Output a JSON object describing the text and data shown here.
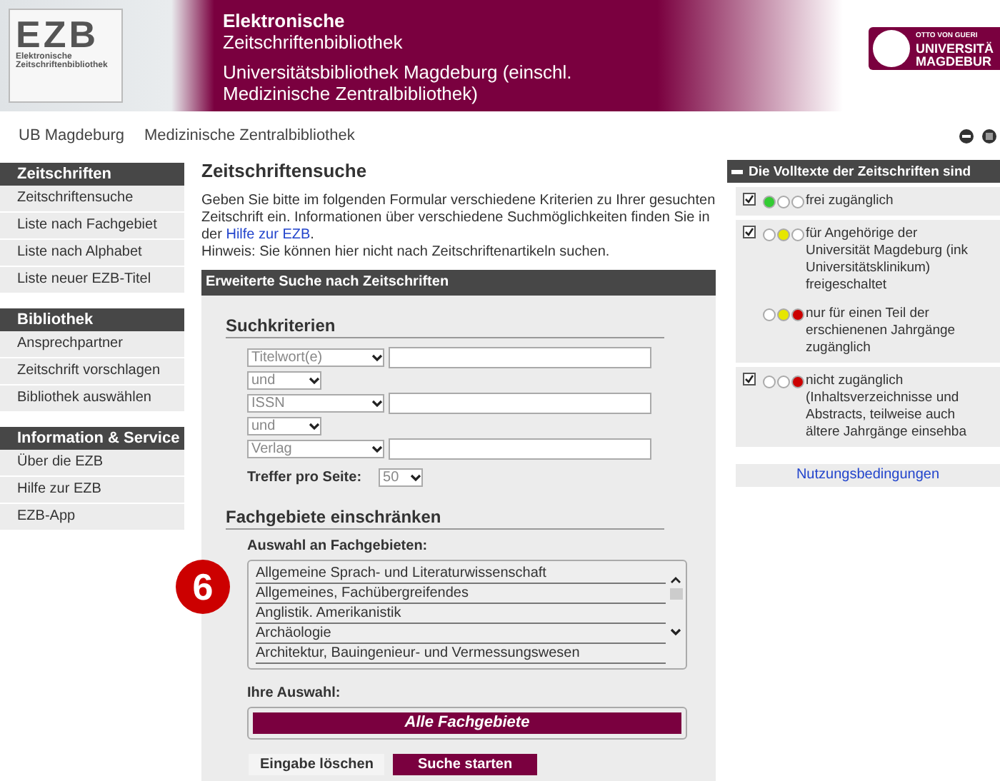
{
  "header": {
    "logo": {
      "letters": "EZB",
      "line1": "Elektronische",
      "line2": "Zeitschriftenbibliothek"
    },
    "title": "Elektronische",
    "subtitle": "Zeitschriftenbibliothek",
    "library": "Universitätsbibliothek Magdeburg (einschl. Medizinische Zentralbibliothek)",
    "uni_logo": {
      "small": "OTTO VON GUERI",
      "line1": "UNIVERSITÄ",
      "line2": "MAGDEBUR"
    }
  },
  "nav_links": [
    "UB Magdeburg",
    "Medizinische Zentralbibliothek"
  ],
  "sidebar": [
    {
      "heading": "Zeitschriften",
      "items": [
        "Zeitschriftensuche",
        "Liste nach Fachgebiet",
        "Liste nach Alphabet",
        "Liste neuer EZB-Titel"
      ]
    },
    {
      "heading": "Bibliothek",
      "items": [
        "Ansprechpartner",
        "Zeitschrift vorschlagen",
        "Bibliothek auswählen"
      ]
    },
    {
      "heading": "Information & Service",
      "items": [
        "Über die EZB",
        "Hilfe zur EZB",
        "EZB-App"
      ]
    }
  ],
  "main": {
    "title": "Zeitschriftensuche",
    "intro": "Geben Sie bitte im folgenden Formular verschiedene Kriterien zu Ihrer gesuchten Zeitschrift ein. Informationen über verschiedene Suchmöglichkeiten finden Sie in der",
    "intro_link": "Hilfe zur EZB",
    "intro_end": ".",
    "hint": "Hinweis: Sie können hier nicht nach Zeitschriftenartikeln suchen.",
    "panel_title": "Erweiterte Suche nach Zeitschriften",
    "criteria_heading": "Suchkriterien",
    "criteria": [
      {
        "field": "Titelwort(e)",
        "operator": "und"
      },
      {
        "field": "ISSN",
        "operator": "und"
      },
      {
        "field": "Verlag"
      }
    ],
    "hits_label": "Treffer pro Seite:",
    "hits_value": "50",
    "subjects_heading": "Fachgebiete einschränken",
    "subjects_label": "Auswahl an Fachgebieten:",
    "subjects": [
      "Allgemeine Sprach- und Literaturwissenschaft",
      "Allgemeines, Fachübergreifendes",
      "Anglistik. Amerikanistik",
      "Archäologie",
      "Architektur, Bauingenieur- und Vermessungswesen"
    ],
    "selection_label": "Ihre Auswahl:",
    "selection": "Alle Fachgebiete",
    "buttons": [
      {
        "label": "Eingabe löschen",
        "kind": "plain"
      },
      {
        "label": "Suche starten",
        "kind": "primary"
      }
    ]
  },
  "annotation": "6",
  "legend": {
    "title": "Die Volltexte der Zeitschriften sind",
    "groups": [
      {
        "rows": [
          {
            "checked": true,
            "lights": [
              {
                "color": "#33cc33"
              },
              {
                "color": "#ffffff"
              },
              {
                "color": "#ffffff"
              }
            ],
            "lines": [
              "frei zugänglich"
            ]
          }
        ]
      },
      {
        "rows": [
          {
            "checked": true,
            "lights": [
              {
                "color": "#ffffff"
              },
              {
                "color": "#e6e600"
              },
              {
                "color": "#ffffff"
              }
            ],
            "lines": [
              "für Angehörige der",
              "Universität Magdeburg (ink",
              "Universitätsklinikum)",
              "freigeschaltet"
            ]
          },
          {
            "lights": [
              {
                "color": "#ffffff"
              },
              {
                "color": "#e6e600"
              },
              {
                "color": "#cc0000"
              }
            ],
            "lines": [
              "nur für einen Teil der",
              "erschienenen Jahrgänge",
              "zugänglich"
            ]
          }
        ]
      },
      {
        "rows": [
          {
            "checked": true,
            "lights": [
              {
                "color": "#ffffff"
              },
              {
                "color": "#ffffff"
              },
              {
                "color": "#cc0000"
              }
            ],
            "lines": [
              "nicht zugänglich",
              "(Inhaltsverzeichnisse und",
              "Abstracts, teilweise auch",
              "ältere Jahrgänge einsehba"
            ]
          }
        ]
      }
    ],
    "terms_link": "Nutzungsbedingungen"
  }
}
